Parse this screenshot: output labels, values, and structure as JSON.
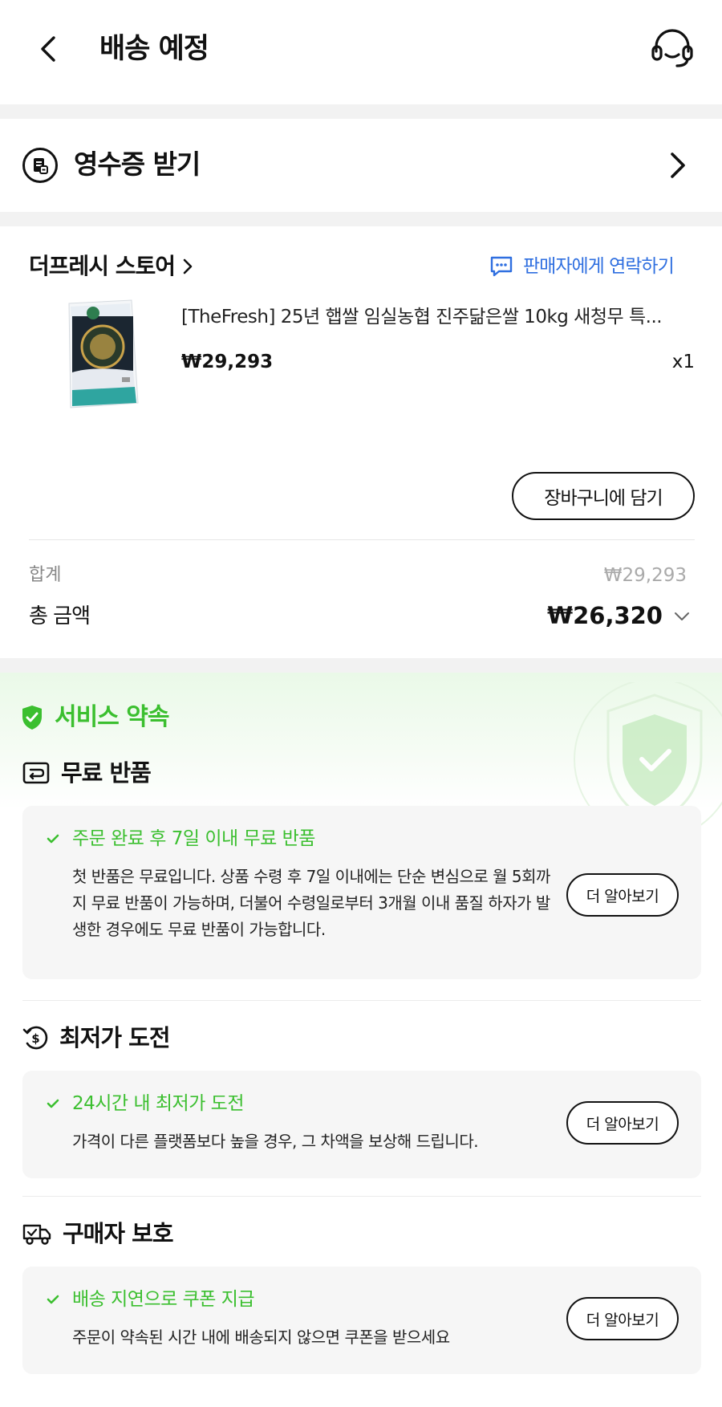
{
  "header": {
    "title": "배송 예정",
    "back_icon": "back-arrow-icon",
    "support_icon": "headset-icon"
  },
  "receipt": {
    "label": "영수증 받기",
    "icon": "receipt-icon"
  },
  "order": {
    "store_name": "더프레시 스토어",
    "contact_seller": "판매자에게 연락하기",
    "product": {
      "name": "[TheFresh] 25년 햅쌀 임실농협 진주닮은쌀 10kg 새청무 특...",
      "price": "₩29,293",
      "quantity": "x1"
    },
    "add_to_cart": "장바구니에 담기",
    "subtotal_label": "합계",
    "subtotal_value": "₩29,293",
    "total_label": "총 금액",
    "total_value": "₩26,320"
  },
  "service": {
    "title": "서비스 약속",
    "accent_color": "#3bbf2f",
    "sections": [
      {
        "heading": "무료 반품",
        "icon": "return-box-icon",
        "headline": "주문 완료 후 7일 이내 무료 반품",
        "body": "첫 반품은 무료입니다. 상품 수령 후 7일 이내에는 단순 변심으로 월 5회까지 무료 반품이 가능하며, 더불어 수령일로부터 3개월 이내 품질 하자가 발생한 경우에도 무료 반품이 가능합니다.",
        "button": "더 알아보기"
      },
      {
        "heading": "최저가 도전",
        "icon": "price-shield-icon",
        "headline": "24시간 내 최저가 도전",
        "body": "가격이 다른 플랫폼보다 높을 경우, 그 차액을 보상해 드립니다.",
        "button": "더 알아보기"
      },
      {
        "heading": "구매자 보호",
        "icon": "delivery-truck-icon",
        "headline": "배송 지연으로 쿠폰 지급",
        "body": "주문이 약속된 시간 내에 배송되지 않으면 쿠폰을 받으세요",
        "button": "더 알아보기"
      }
    ]
  }
}
